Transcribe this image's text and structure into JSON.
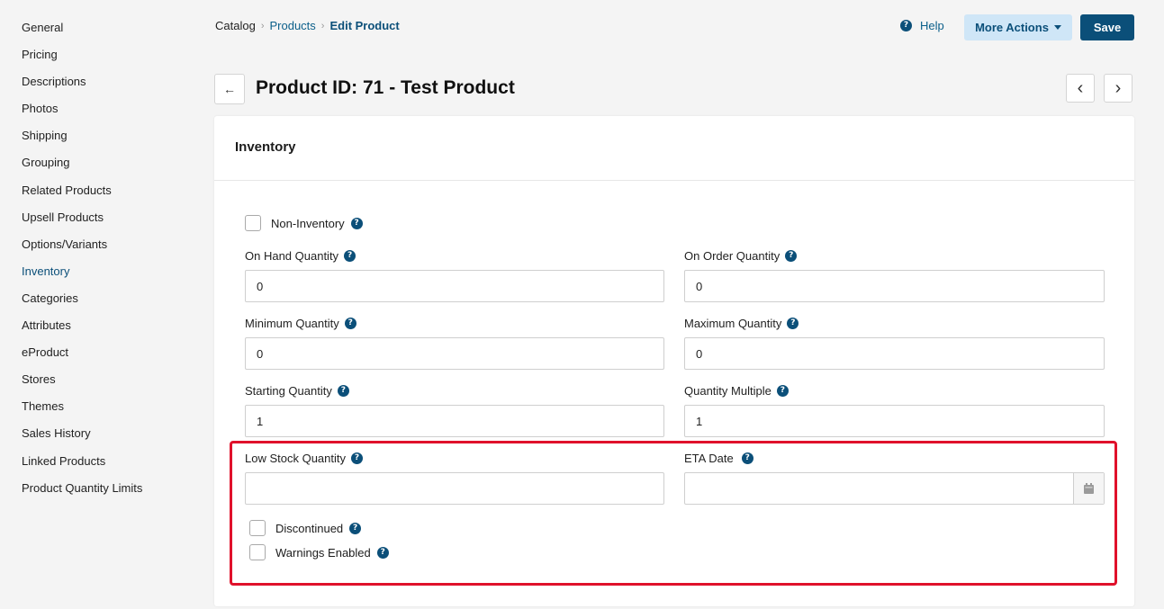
{
  "sidebar": {
    "items": [
      {
        "label": "General"
      },
      {
        "label": "Pricing"
      },
      {
        "label": "Descriptions"
      },
      {
        "label": "Photos"
      },
      {
        "label": "Shipping"
      },
      {
        "label": "Grouping"
      },
      {
        "label": "Related Products"
      },
      {
        "label": "Upsell Products"
      },
      {
        "label": "Options/Variants"
      },
      {
        "label": "Inventory"
      },
      {
        "label": "Categories"
      },
      {
        "label": "Attributes"
      },
      {
        "label": "eProduct"
      },
      {
        "label": "Stores"
      },
      {
        "label": "Themes"
      },
      {
        "label": "Sales History"
      },
      {
        "label": "Linked Products"
      },
      {
        "label": "Product Quantity Limits"
      }
    ],
    "active": "Inventory"
  },
  "breadcrumb": {
    "catalog": "Catalog",
    "products": "Products",
    "current": "Edit Product",
    "separator": "›"
  },
  "header": {
    "help_label": "Help",
    "help_icon": "question-circle-icon",
    "more_actions_label": "More Actions",
    "save_label": "Save",
    "title": "Product ID: 71 - Test Product"
  },
  "nav": {
    "back_icon": "←",
    "prev_icon": "‹",
    "next_icon": "›"
  },
  "card": {
    "title": "Inventory",
    "non_inventory_label": "Non-Inventory",
    "fields": {
      "on_hand": {
        "label": "On Hand Quantity",
        "value": "0"
      },
      "on_order": {
        "label": "On Order Quantity",
        "value": "0"
      },
      "minimum": {
        "label": "Minimum Quantity",
        "value": "0"
      },
      "maximum": {
        "label": "Maximum Quantity",
        "value": "0"
      },
      "starting": {
        "label": "Starting Quantity",
        "value": "1"
      },
      "multiple": {
        "label": "Quantity Multiple",
        "value": "1"
      },
      "low_stock": {
        "label": "Low Stock Quantity",
        "value": ""
      },
      "eta_date": {
        "label": "ETA Date",
        "value": ""
      }
    },
    "discontinued_label": "Discontinued",
    "warnings_label": "Warnings Enabled"
  },
  "qmark_glyph": "?",
  "colors": {
    "accent": "#0b4f79",
    "highlight": "#e0112b",
    "more_actions_bg": "#cfe6f7"
  }
}
